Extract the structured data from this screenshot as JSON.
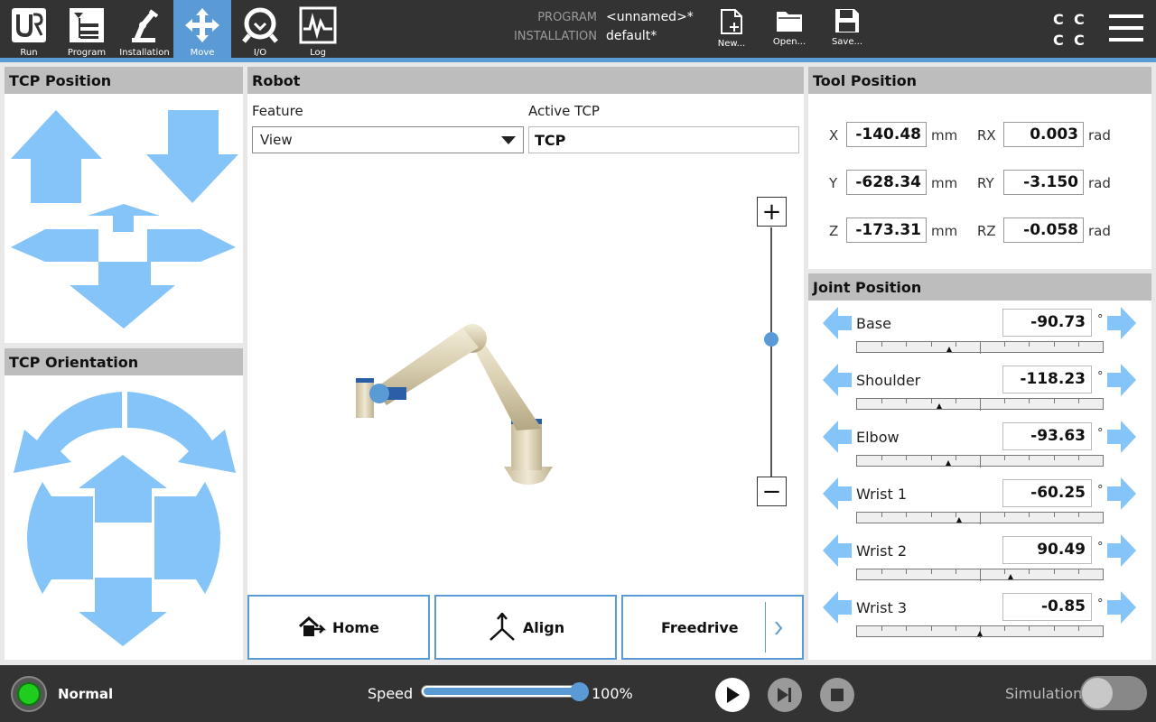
{
  "nav": {
    "tabs": [
      {
        "label": "Run",
        "icon": "ur-logo-icon"
      },
      {
        "label": "Program",
        "icon": "program-icon"
      },
      {
        "label": "Installation",
        "icon": "robot-arm-icon"
      },
      {
        "label": "Move",
        "icon": "move-cross-icon",
        "active": true
      },
      {
        "label": "I/O",
        "icon": "io-icon"
      },
      {
        "label": "Log",
        "icon": "log-icon"
      }
    ]
  },
  "program_info": {
    "program_key": "PROGRAM",
    "program_value": "<unnamed>*",
    "installation_key": "INSTALLATION",
    "installation_value": "default*"
  },
  "file_buttons": {
    "new": "New...",
    "open": "Open...",
    "save": "Save..."
  },
  "cc_glyphs": [
    "C",
    "C",
    "C",
    "C"
  ],
  "tcp_position": {
    "title": "TCP Position"
  },
  "tcp_orientation": {
    "title": "TCP Orientation"
  },
  "robot": {
    "title": "Robot",
    "feature_label": "Feature",
    "feature_value": "View",
    "active_tcp_label": "Active TCP",
    "active_tcp_value": "TCP",
    "zoom_level": 0.45,
    "buttons": {
      "home": "Home",
      "align": "Align",
      "freedrive": "Freedrive"
    }
  },
  "tool_position": {
    "title": "Tool Position",
    "rows": [
      {
        "axis": "X",
        "value": "-140.48",
        "unit": "mm",
        "raxis": "RX",
        "rvalue": "0.003",
        "runit": "rad"
      },
      {
        "axis": "Y",
        "value": "-628.34",
        "unit": "mm",
        "raxis": "RY",
        "rvalue": "-3.150",
        "runit": "rad"
      },
      {
        "axis": "Z",
        "value": "-173.31",
        "unit": "mm",
        "raxis": "RZ",
        "rvalue": "-0.058",
        "runit": "rad"
      }
    ]
  },
  "joint_position": {
    "title": "Joint Position",
    "unit": "°",
    "joints": [
      {
        "name": "Base",
        "value": "-90.73",
        "slider": 0.374
      },
      {
        "name": "Shoulder",
        "value": "-118.23",
        "slider": 0.336
      },
      {
        "name": "Elbow",
        "value": "-93.63",
        "slider": 0.37
      },
      {
        "name": "Wrist 1",
        "value": "-60.25",
        "slider": 0.416
      },
      {
        "name": "Wrist 2",
        "value": "90.49",
        "slider": 0.626
      },
      {
        "name": "Wrist 3",
        "value": "-0.85",
        "slider": 0.5
      }
    ]
  },
  "bottom": {
    "status": "Normal",
    "speed_label": "Speed",
    "speed_value": "100%",
    "speed_fraction": 1.0,
    "simulation_label": "Simulation"
  },
  "colors": {
    "accent": "#5b9bd5",
    "arrow": "#84c4f8",
    "status_green": "#1fcc1f"
  }
}
